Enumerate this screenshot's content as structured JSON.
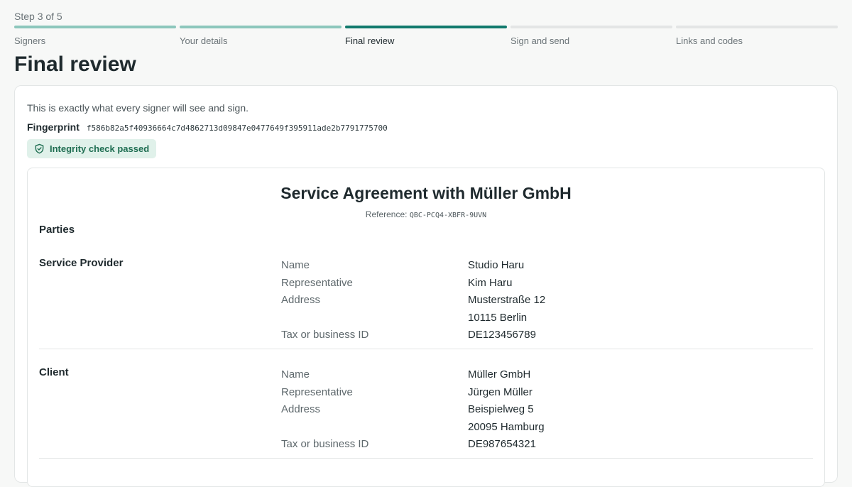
{
  "wizard": {
    "step_text": "Step 3 of 5",
    "steps": [
      {
        "label": "Signers",
        "state": "done"
      },
      {
        "label": "Your details",
        "state": "done"
      },
      {
        "label": "Final review",
        "state": "current"
      },
      {
        "label": "Sign and send",
        "state": "upcoming"
      },
      {
        "label": "Links and codes",
        "state": "upcoming"
      }
    ]
  },
  "page": {
    "title": "Final review"
  },
  "review": {
    "intro": "This is exactly what every signer will see and sign.",
    "fingerprint_label": "Fingerprint",
    "fingerprint_value": "f586b82a5f40936664c7d4862713d09847e0477649f395911ade2b7791775700",
    "integrity_badge": "Integrity check passed",
    "integrity_icon": "shield-check-icon"
  },
  "document": {
    "title": "Service Agreement with Müller GmbH",
    "reference_label": "Reference:",
    "reference_code": "QBC-PCQ4-XBFR-9UVN",
    "parties_heading": "Parties",
    "parties": [
      {
        "role": "Service Provider",
        "labels": [
          "Name",
          "Representative",
          "Address",
          "",
          "Tax or business ID"
        ],
        "values": [
          "Studio Haru",
          "Kim Haru",
          "Musterstraße 12",
          "10115 Berlin",
          "DE123456789"
        ]
      },
      {
        "role": "Client",
        "labels": [
          "Name",
          "Representative",
          "Address",
          "",
          "Tax or business ID"
        ],
        "values": [
          "Müller GmbH",
          "Jürgen Müller",
          "Beispielweg 5",
          "20095 Hamburg",
          "DE987654321"
        ]
      }
    ]
  },
  "colors": {
    "accent": "#127a6d",
    "step_done": "#8cc7bc",
    "badge_bg": "#e0f1ea",
    "badge_text": "#1f6e52"
  }
}
